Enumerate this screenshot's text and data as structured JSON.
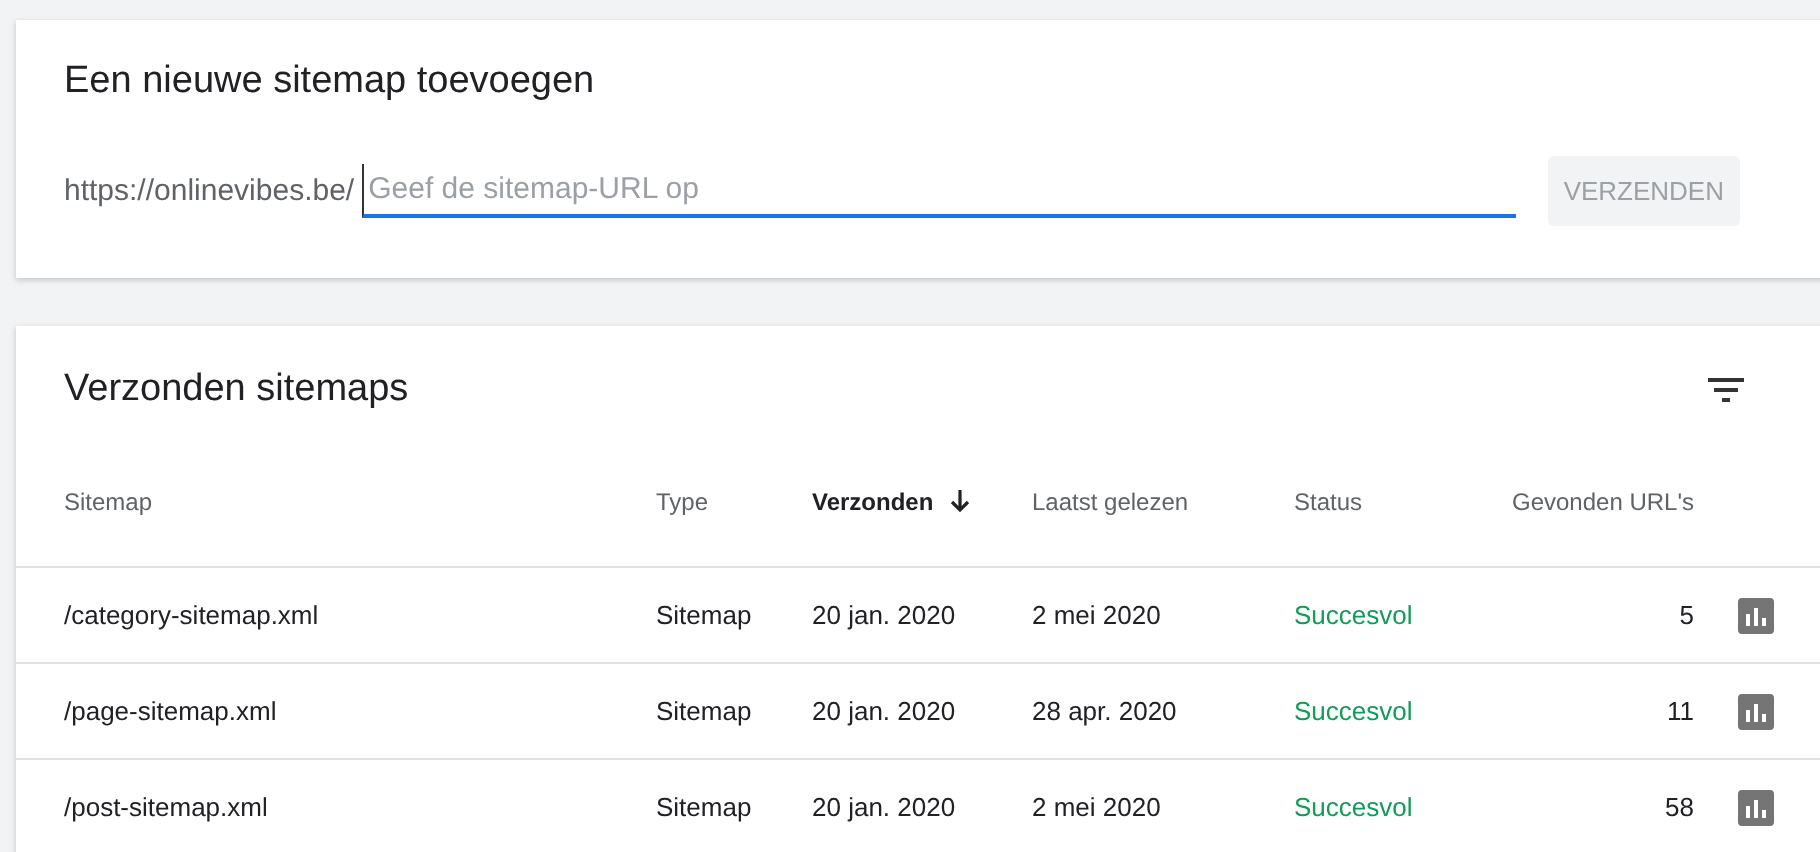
{
  "add_card": {
    "title": "Een nieuwe sitemap toevoegen",
    "prefix": "https://onlinevibes.be/",
    "field": {
      "placeholder": "Geef de sitemap-URL op"
    },
    "button": {
      "label": "VERZENDEN",
      "disabled": true
    }
  },
  "sitemaps_card": {
    "title": "Verzonden sitemaps",
    "columns": [
      {
        "label": "Sitemap",
        "sorted": false
      },
      {
        "label": "Type",
        "sorted": false
      },
      {
        "label": "Verzonden",
        "sorted": true
      },
      {
        "label": "Laatst gelezen",
        "sorted": false
      },
      {
        "label": "Status",
        "sorted": false
      },
      {
        "label": "Gevonden URL's",
        "sorted": false
      }
    ],
    "rows": [
      {
        "cells": [
          "/category-sitemap.xml",
          "Sitemap",
          "20 jan. 2020",
          "2 mei 2020",
          "Succesvol",
          "5"
        ]
      },
      {
        "cells": [
          "/page-sitemap.xml",
          "Sitemap",
          "20 jan. 2020",
          "28 apr. 2020",
          "Succesvol",
          "11"
        ]
      },
      {
        "cells": [
          "/post-sitemap.xml",
          "Sitemap",
          "20 jan. 2020",
          "2 mei 2020",
          "Succesvol",
          "58"
        ]
      }
    ]
  }
}
